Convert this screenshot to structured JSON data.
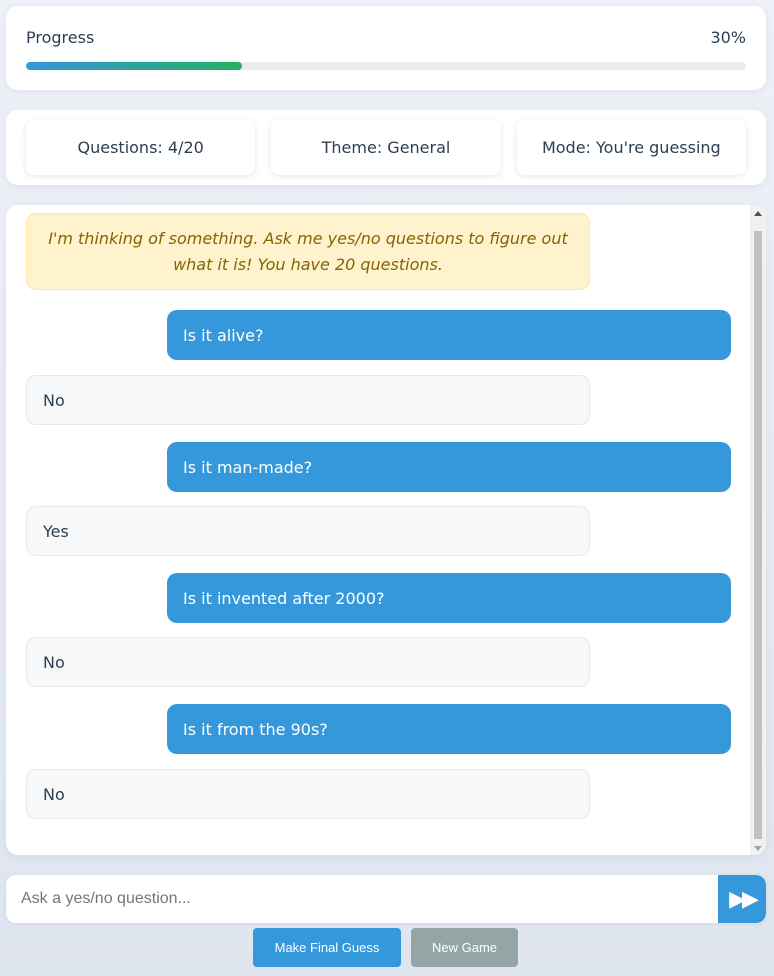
{
  "progress": {
    "label": "Progress",
    "value_text": "30%",
    "fraction": 0.3
  },
  "stats": {
    "questions": "Questions: 4/20",
    "theme": "Theme: General",
    "mode": "Mode: You're guessing"
  },
  "chat": {
    "intro": "I'm thinking of something. Ask me yes/no questions to figure out what it is! You have 20 questions.",
    "messages": [
      {
        "role": "user",
        "text": "Is it alive?"
      },
      {
        "role": "bot",
        "text": "No"
      },
      {
        "role": "user",
        "text": "Is it man-made?"
      },
      {
        "role": "bot",
        "text": "Yes"
      },
      {
        "role": "user",
        "text": "Is it invented after 2000?"
      },
      {
        "role": "bot",
        "text": "No"
      },
      {
        "role": "user",
        "text": "Is it from the 90s?"
      },
      {
        "role": "bot",
        "text": "No"
      }
    ]
  },
  "input": {
    "placeholder": "Ask a yes/no question...",
    "value": ""
  },
  "send": {
    "icon": "fast-forward-icon",
    "glyph": "▶▶"
  },
  "buttons": {
    "final_guess": "Make Final Guess",
    "new_game": "New Game"
  },
  "colors": {
    "accent": "#3498db",
    "success": "#27ae60",
    "secondary": "#95a5a6",
    "hint_bg": "#fff3cd",
    "hint_text": "#856404"
  }
}
